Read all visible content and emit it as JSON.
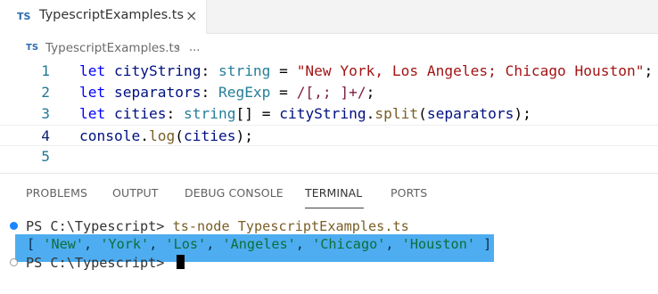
{
  "editor_tab": {
    "badge": "TS",
    "title": "TypescriptExamples.ts",
    "close_glyph": "×"
  },
  "breadcrumb": {
    "badge": "TS",
    "file": "TypescriptExamples.ts",
    "separator": "›",
    "more": "..."
  },
  "code": {
    "lines": [
      {
        "num": "1"
      },
      {
        "num": "2"
      },
      {
        "num": "3"
      },
      {
        "num": "4"
      },
      {
        "num": "5"
      }
    ],
    "tokens": {
      "l1": {
        "let": "let ",
        "id": "cityString",
        "colon": ": ",
        "type": "string",
        "eq": " = ",
        "str": "\"New York, Los Angeles; Chicago Houston\"",
        "end": ";"
      },
      "l2": {
        "let": "let ",
        "id": "separators",
        "colon": ": ",
        "type": "RegExp",
        "eq": " = ",
        "regex": "/[,; ]+/",
        "end": ";"
      },
      "l3": {
        "let": "let ",
        "id": "cities",
        "colon": ": ",
        "type": "string",
        "arr": "[]",
        "eq": " = ",
        "obj": "cityString",
        "dot": ".",
        "fn": "split",
        "open": "(",
        "arg": "separators",
        "close": ");"
      },
      "l4": {
        "obj": "console",
        "dot": ".",
        "fn": "log",
        "open": "(",
        "arg": "cities",
        "close": ");"
      }
    }
  },
  "panel": {
    "tabs": [
      "PROBLEMS",
      "OUTPUT",
      "DEBUG CONSOLE",
      "TERMINAL",
      "PORTS"
    ],
    "active_tab": "TERMINAL"
  },
  "terminal": {
    "prompt1": "PS C:\\Typescript> ",
    "command": "ts-node TypescriptExamples.ts",
    "output": {
      "open": "[ ",
      "items": [
        "'New'",
        "'York'",
        "'Los'",
        "'Angeles'",
        "'Chicago'",
        "'Houston'"
      ],
      "sep": ", ",
      "close": " ]"
    },
    "prompt2": "PS C:\\Typescript> "
  },
  "colors": {
    "keyword": "#0000ff",
    "type": "#267f99",
    "string": "#a31515",
    "selection": "#3ba4ee",
    "line_number": "#237893"
  }
}
